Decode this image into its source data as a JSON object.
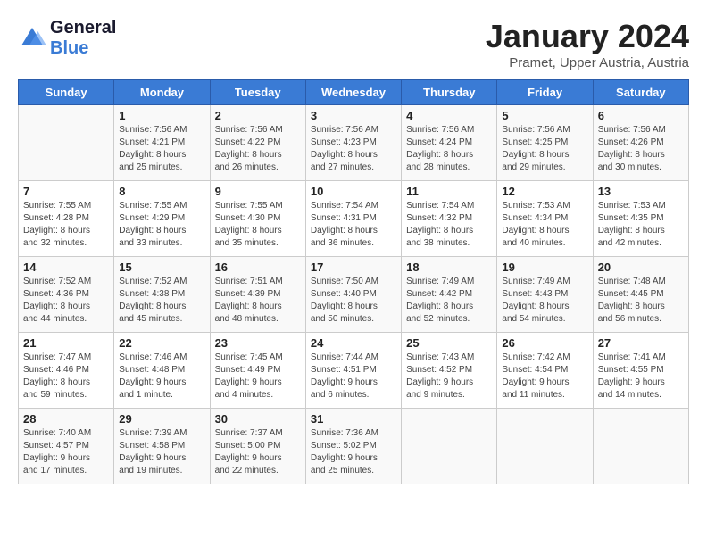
{
  "header": {
    "logo_line1": "General",
    "logo_line2": "Blue",
    "calendar_title": "January 2024",
    "calendar_subtitle": "Pramet, Upper Austria, Austria"
  },
  "weekdays": [
    "Sunday",
    "Monday",
    "Tuesday",
    "Wednesday",
    "Thursday",
    "Friday",
    "Saturday"
  ],
  "weeks": [
    [
      {
        "day": "",
        "info": ""
      },
      {
        "day": "1",
        "info": "Sunrise: 7:56 AM\nSunset: 4:21 PM\nDaylight: 8 hours\nand 25 minutes."
      },
      {
        "day": "2",
        "info": "Sunrise: 7:56 AM\nSunset: 4:22 PM\nDaylight: 8 hours\nand 26 minutes."
      },
      {
        "day": "3",
        "info": "Sunrise: 7:56 AM\nSunset: 4:23 PM\nDaylight: 8 hours\nand 27 minutes."
      },
      {
        "day": "4",
        "info": "Sunrise: 7:56 AM\nSunset: 4:24 PM\nDaylight: 8 hours\nand 28 minutes."
      },
      {
        "day": "5",
        "info": "Sunrise: 7:56 AM\nSunset: 4:25 PM\nDaylight: 8 hours\nand 29 minutes."
      },
      {
        "day": "6",
        "info": "Sunrise: 7:56 AM\nSunset: 4:26 PM\nDaylight: 8 hours\nand 30 minutes."
      }
    ],
    [
      {
        "day": "7",
        "info": "Sunrise: 7:55 AM\nSunset: 4:28 PM\nDaylight: 8 hours\nand 32 minutes."
      },
      {
        "day": "8",
        "info": "Sunrise: 7:55 AM\nSunset: 4:29 PM\nDaylight: 8 hours\nand 33 minutes."
      },
      {
        "day": "9",
        "info": "Sunrise: 7:55 AM\nSunset: 4:30 PM\nDaylight: 8 hours\nand 35 minutes."
      },
      {
        "day": "10",
        "info": "Sunrise: 7:54 AM\nSunset: 4:31 PM\nDaylight: 8 hours\nand 36 minutes."
      },
      {
        "day": "11",
        "info": "Sunrise: 7:54 AM\nSunset: 4:32 PM\nDaylight: 8 hours\nand 38 minutes."
      },
      {
        "day": "12",
        "info": "Sunrise: 7:53 AM\nSunset: 4:34 PM\nDaylight: 8 hours\nand 40 minutes."
      },
      {
        "day": "13",
        "info": "Sunrise: 7:53 AM\nSunset: 4:35 PM\nDaylight: 8 hours\nand 42 minutes."
      }
    ],
    [
      {
        "day": "14",
        "info": "Sunrise: 7:52 AM\nSunset: 4:36 PM\nDaylight: 8 hours\nand 44 minutes."
      },
      {
        "day": "15",
        "info": "Sunrise: 7:52 AM\nSunset: 4:38 PM\nDaylight: 8 hours\nand 45 minutes."
      },
      {
        "day": "16",
        "info": "Sunrise: 7:51 AM\nSunset: 4:39 PM\nDaylight: 8 hours\nand 48 minutes."
      },
      {
        "day": "17",
        "info": "Sunrise: 7:50 AM\nSunset: 4:40 PM\nDaylight: 8 hours\nand 50 minutes."
      },
      {
        "day": "18",
        "info": "Sunrise: 7:49 AM\nSunset: 4:42 PM\nDaylight: 8 hours\nand 52 minutes."
      },
      {
        "day": "19",
        "info": "Sunrise: 7:49 AM\nSunset: 4:43 PM\nDaylight: 8 hours\nand 54 minutes."
      },
      {
        "day": "20",
        "info": "Sunrise: 7:48 AM\nSunset: 4:45 PM\nDaylight: 8 hours\nand 56 minutes."
      }
    ],
    [
      {
        "day": "21",
        "info": "Sunrise: 7:47 AM\nSunset: 4:46 PM\nDaylight: 8 hours\nand 59 minutes."
      },
      {
        "day": "22",
        "info": "Sunrise: 7:46 AM\nSunset: 4:48 PM\nDaylight: 9 hours\nand 1 minute."
      },
      {
        "day": "23",
        "info": "Sunrise: 7:45 AM\nSunset: 4:49 PM\nDaylight: 9 hours\nand 4 minutes."
      },
      {
        "day": "24",
        "info": "Sunrise: 7:44 AM\nSunset: 4:51 PM\nDaylight: 9 hours\nand 6 minutes."
      },
      {
        "day": "25",
        "info": "Sunrise: 7:43 AM\nSunset: 4:52 PM\nDaylight: 9 hours\nand 9 minutes."
      },
      {
        "day": "26",
        "info": "Sunrise: 7:42 AM\nSunset: 4:54 PM\nDaylight: 9 hours\nand 11 minutes."
      },
      {
        "day": "27",
        "info": "Sunrise: 7:41 AM\nSunset: 4:55 PM\nDaylight: 9 hours\nand 14 minutes."
      }
    ],
    [
      {
        "day": "28",
        "info": "Sunrise: 7:40 AM\nSunset: 4:57 PM\nDaylight: 9 hours\nand 17 minutes."
      },
      {
        "day": "29",
        "info": "Sunrise: 7:39 AM\nSunset: 4:58 PM\nDaylight: 9 hours\nand 19 minutes."
      },
      {
        "day": "30",
        "info": "Sunrise: 7:37 AM\nSunset: 5:00 PM\nDaylight: 9 hours\nand 22 minutes."
      },
      {
        "day": "31",
        "info": "Sunrise: 7:36 AM\nSunset: 5:02 PM\nDaylight: 9 hours\nand 25 minutes."
      },
      {
        "day": "",
        "info": ""
      },
      {
        "day": "",
        "info": ""
      },
      {
        "day": "",
        "info": ""
      }
    ]
  ]
}
